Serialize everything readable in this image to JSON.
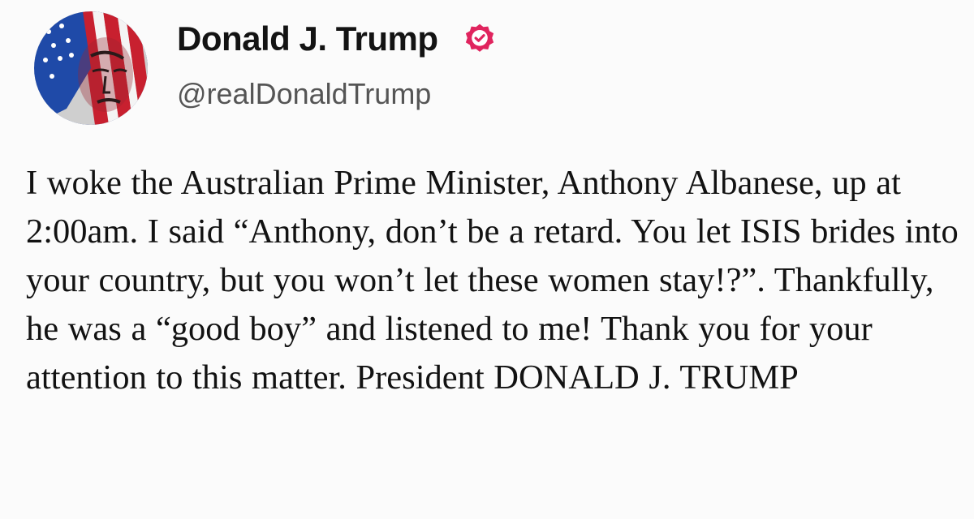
{
  "author": {
    "name": "Donald J. Trump",
    "handle": "@realDonaldTrump",
    "avatar_icon": "flag-portrait-avatar",
    "verified_icon": "verified-badge-icon",
    "verified_color": "#e0245e"
  },
  "post": {
    "text": "I woke the Australian Prime Minister, Anthony Albanese, up at 2:00am. I said “Anthony, don’t be a retard. You let ISIS brides into your country, but you won’t let these women stay!?”. Thankfully, he was a “good boy” and listened to me! Thank you for your attention to this matter. President DONALD J. TRUMP"
  },
  "colors": {
    "background": "#fbfbfb",
    "text": "#121212",
    "handle": "#555555"
  }
}
